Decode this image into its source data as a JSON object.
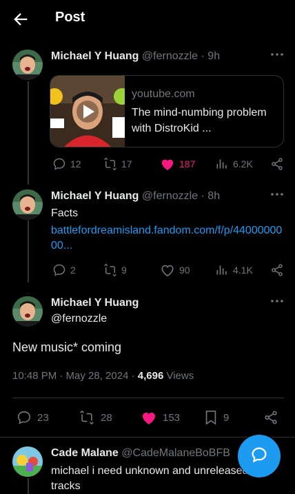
{
  "header": {
    "title": "Post"
  },
  "reply1": {
    "name": "Michael Y Huang",
    "handle": "@fernozzle",
    "time": "· 9h",
    "card": {
      "domain": "youtube.com",
      "title": "The mind-numbing problem with DistroKid ..."
    },
    "actions": {
      "replies": "12",
      "reposts": "17",
      "likes": "187",
      "views": "6.2K"
    }
  },
  "reply2": {
    "name": "Michael Y Huang",
    "handle": "@fernozzle",
    "time": "· 8h",
    "text": "Facts",
    "link": "battlefordreamisland.fandom.com/f/p/4400000000...",
    "actions": {
      "replies": "2",
      "reposts": "9",
      "likes": "90",
      "views": "4.1K"
    }
  },
  "main_post": {
    "name": "Michael Y Huang",
    "handle": "@fernozzle",
    "text": "New music* coming",
    "timestamp": "10:48 PM · May 28, 2024 · ",
    "views_count": "4,696",
    "views_label": " Views",
    "actions": {
      "replies": "23",
      "reposts": "28",
      "likes": "153",
      "bookmarks": "9"
    }
  },
  "reply3": {
    "name": "Cade Malane",
    "handle": "@CadeMalaneBoBFB",
    "text": "michael i need unknown and unreleased tracks"
  },
  "colors": {
    "accent": "#1d9bf0",
    "like": "#f91880",
    "muted": "#71767b",
    "bg": "#000000"
  }
}
